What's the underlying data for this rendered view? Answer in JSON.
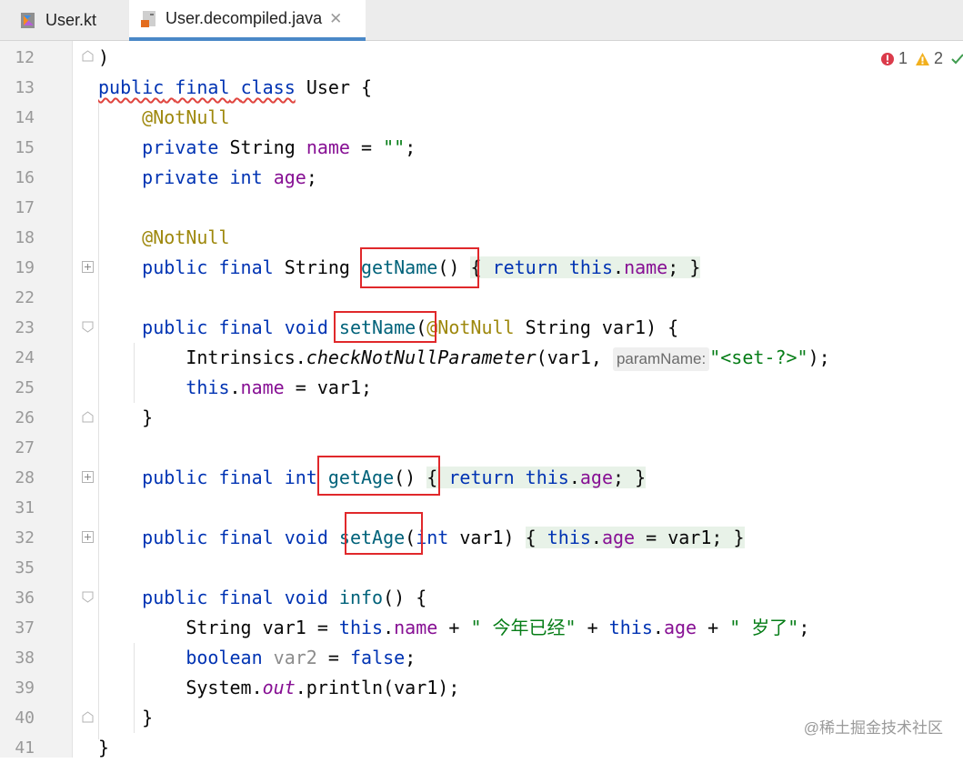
{
  "tabs": [
    {
      "label": "User.kt",
      "icon": "kotlin-file-icon",
      "active": false
    },
    {
      "label": "User.decompiled.java",
      "icon": "java-class-file-icon",
      "active": true
    }
  ],
  "inspections": {
    "errors": "1",
    "warnings": "2"
  },
  "line_numbers": [
    "12",
    "13",
    "14",
    "15",
    "16",
    "17",
    "18",
    "19",
    "22",
    "23",
    "24",
    "25",
    "26",
    "27",
    "28",
    "31",
    "32",
    "35",
    "36",
    "37",
    "38",
    "39",
    "40",
    "41"
  ],
  "code": {
    "l12": ")",
    "l13": [
      "public",
      "final",
      "class",
      "User {"
    ],
    "l14": "@NotNull",
    "l15": [
      "private",
      "String",
      "name",
      "=",
      "\"\"",
      ";"
    ],
    "l16": [
      "private",
      "int",
      "age",
      ";"
    ],
    "l18": "@NotNull",
    "l19": [
      "public final",
      "String",
      "getName",
      "()",
      "{",
      "return",
      "this",
      "name",
      ";",
      "}"
    ],
    "l23": [
      "public final void",
      "setName",
      "(",
      "@NotNull",
      "String var1) {"
    ],
    "l24": [
      "Intrinsics.",
      "checkNotNullParameter",
      "(var1,",
      "paramName:",
      "\"<set-?>\"",
      ");"
    ],
    "l25": [
      "this",
      "name",
      "= var1;"
    ],
    "l26": "}",
    "l28": [
      "public final int",
      "getAge",
      "()",
      "{",
      "return",
      "this",
      "age",
      ";",
      "}"
    ],
    "l32": [
      "public final void",
      "setAge",
      "(",
      "int",
      "var1)",
      "{",
      "this",
      "age",
      "= var1;",
      "}"
    ],
    "l36": [
      "public final void",
      "info",
      "() {"
    ],
    "l37": [
      "String var1 =",
      "this",
      "name",
      "+",
      "\" 今年已经\"",
      "+",
      "this",
      "age",
      "+",
      "\" 岁了\"",
      ";"
    ],
    "l38": [
      "boolean",
      "var2",
      "=",
      "false",
      ";"
    ],
    "l39": [
      "System.",
      "out",
      ".println(var1);"
    ],
    "l40": "}",
    "l41": "}"
  },
  "watermark": "@稀土掘金技术社区",
  "colors": {
    "keyword": "#0033b3",
    "field": "#871094",
    "annotation": "#9e880d",
    "string": "#067d17",
    "highlight_box": "#e0282b"
  }
}
